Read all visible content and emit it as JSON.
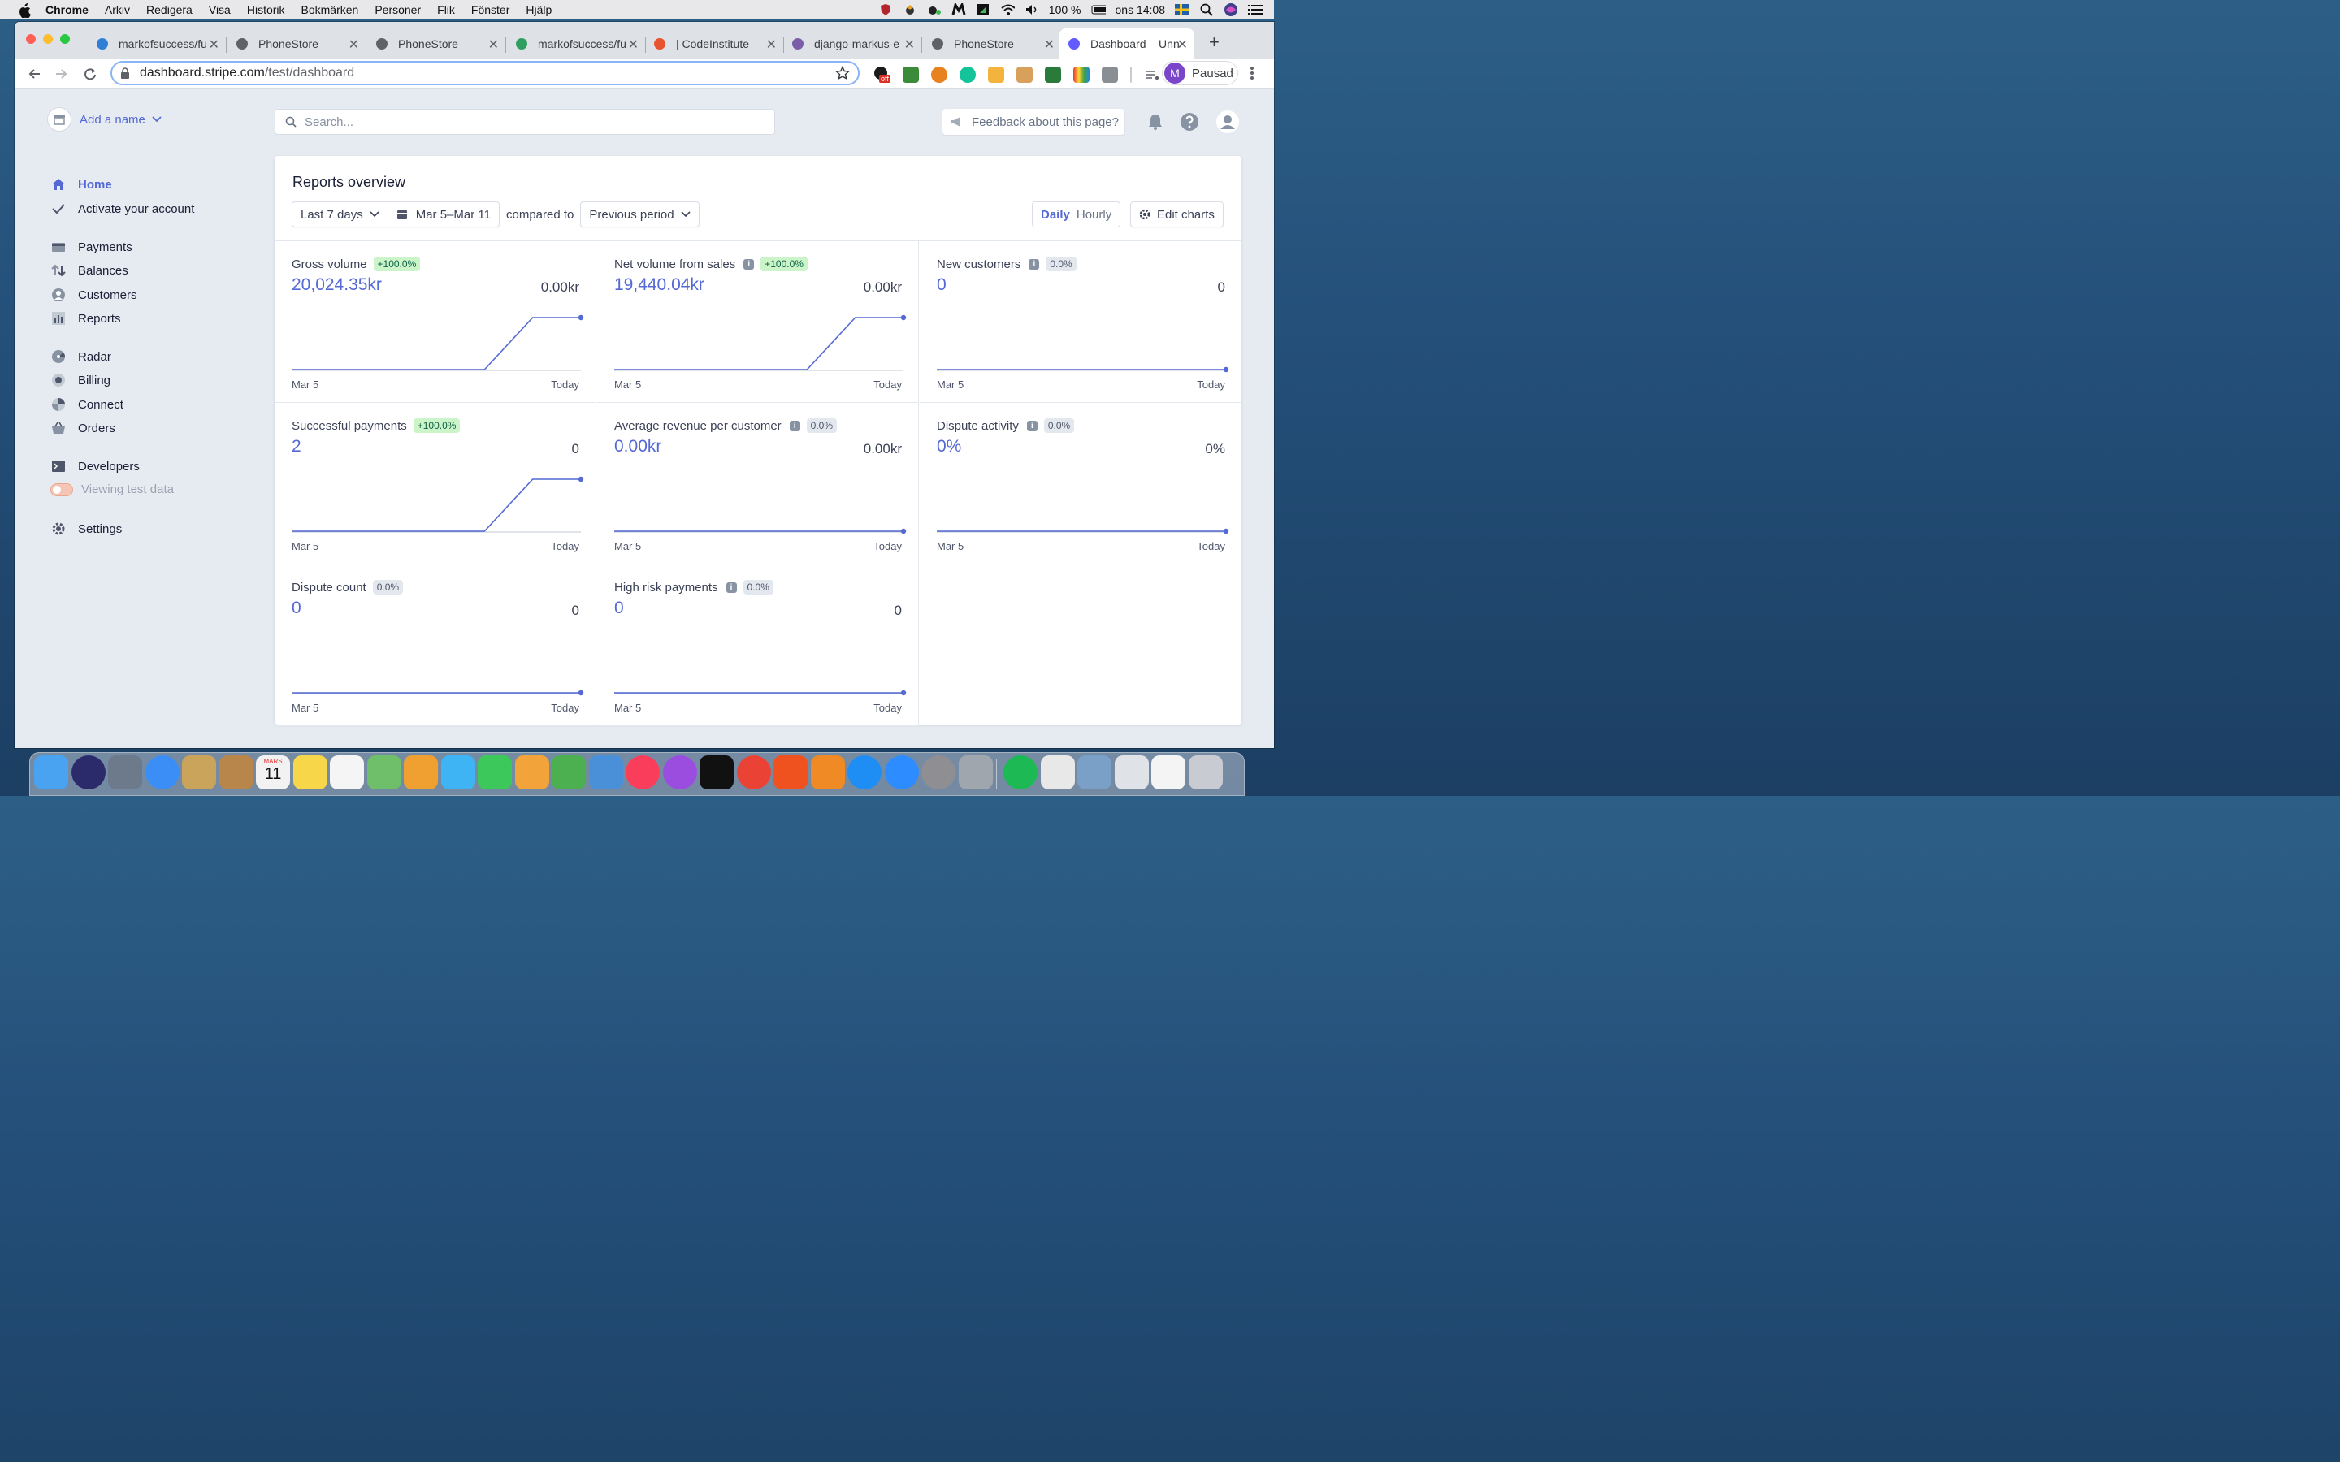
{
  "menubar": {
    "app": "Chrome",
    "items": [
      "Arkiv",
      "Redigera",
      "Visa",
      "Historik",
      "Bokmärken",
      "Personer",
      "Flik",
      "Fönster",
      "Hjälp"
    ],
    "battery": "100 %",
    "clock": "ons 14:08"
  },
  "browser": {
    "tabs": [
      {
        "title": "markofsuccess/fu",
        "icon": "hexagon-icon",
        "color": "#2f7ed8"
      },
      {
        "title": "PhoneStore",
        "icon": "globe-icon",
        "color": "#5f6368"
      },
      {
        "title": "PhoneStore",
        "icon": "globe-icon",
        "color": "#5f6368"
      },
      {
        "title": "markofsuccess/fu",
        "icon": "git-icon",
        "color": "#2e9f5e"
      },
      {
        "title": "| CodeInstitute",
        "icon": "ring-icon",
        "color": "#e8542f"
      },
      {
        "title": "django-markus-e",
        "icon": "heroku-icon",
        "color": "#7b5ea7"
      },
      {
        "title": "PhoneStore",
        "icon": "globe-icon",
        "color": "#5f6368"
      },
      {
        "title": "Dashboard – Unn",
        "icon": "stripe-icon",
        "color": "#635bff"
      }
    ],
    "url_domain": "dashboard.stripe.com",
    "url_path": "/test/dashboard",
    "profile_initial": "M",
    "profile_label": "Pausad",
    "extension_badge": "off"
  },
  "sidebar": {
    "account_name": "Add a name",
    "home": "Home",
    "activate": "Activate your account",
    "group1": [
      "Payments",
      "Balances",
      "Customers",
      "Reports"
    ],
    "group2": [
      "Radar",
      "Billing",
      "Connect",
      "Orders"
    ],
    "developers": "Developers",
    "test_toggle": "Viewing test data",
    "settings": "Settings"
  },
  "header": {
    "search_placeholder": "Search...",
    "feedback": "Feedback about this page?"
  },
  "reports": {
    "title": "Reports overview",
    "range": "Last 7 days",
    "dates": "Mar 5–Mar 11",
    "compared_to": "compared to",
    "comparison": "Previous period",
    "daily": "Daily",
    "hourly": "Hourly",
    "edit_charts": "Edit charts",
    "accent": "#5469d4",
    "metrics": [
      {
        "label": "Gross volume",
        "info": false,
        "badge": "+100.0%",
        "badge_type": "green",
        "value": "20,024.35kr",
        "previous": "0.00kr",
        "x_start": "Mar 5",
        "x_end": "Today",
        "trend": [
          0,
          0,
          0,
          0,
          0,
          1,
          1
        ]
      },
      {
        "label": "Net volume from sales",
        "info": true,
        "badge": "+100.0%",
        "badge_type": "green",
        "value": "19,440.04kr",
        "previous": "0.00kr",
        "x_start": "Mar 5",
        "x_end": "Today",
        "trend": [
          0,
          0,
          0,
          0,
          0,
          1,
          1
        ]
      },
      {
        "label": "New customers",
        "info": true,
        "badge": "0.0%",
        "badge_type": "gray",
        "value": "0",
        "previous": "0",
        "x_start": "Mar 5",
        "x_end": "Today",
        "trend": [
          0,
          0,
          0,
          0,
          0,
          0,
          0
        ]
      },
      {
        "label": "Successful payments",
        "info": false,
        "badge": "+100.0%",
        "badge_type": "green",
        "value": "2",
        "previous": "0",
        "x_start": "Mar 5",
        "x_end": "Today",
        "trend": [
          0,
          0,
          0,
          0,
          0,
          1,
          1
        ]
      },
      {
        "label": "Average revenue per customer",
        "info": true,
        "badge": "0.0%",
        "badge_type": "gray",
        "value": "0.00kr",
        "previous": "0.00kr",
        "x_start": "Mar 5",
        "x_end": "Today",
        "trend": [
          0,
          0,
          0,
          0,
          0,
          0,
          0
        ]
      },
      {
        "label": "Dispute activity",
        "info": true,
        "badge": "0.0%",
        "badge_type": "gray",
        "value": "0%",
        "previous": "0%",
        "x_start": "Mar 5",
        "x_end": "Today",
        "trend": [
          0,
          0,
          0,
          0,
          0,
          0,
          0
        ]
      },
      {
        "label": "Dispute count",
        "info": false,
        "badge": "0.0%",
        "badge_type": "gray",
        "value": "0",
        "previous": "0",
        "x_start": "Mar 5",
        "x_end": "Today",
        "trend": [
          0,
          0,
          0,
          0,
          0,
          0,
          0
        ]
      },
      {
        "label": "High risk payments",
        "info": true,
        "badge": "0.0%",
        "badge_type": "gray",
        "value": "0",
        "previous": "0",
        "x_start": "Mar 5",
        "x_end": "Today",
        "trend": [
          0,
          0,
          0,
          0,
          0,
          0,
          0
        ]
      }
    ]
  },
  "dock": {
    "calendar_month": "MARS",
    "calendar_day": "11",
    "items": [
      "finder-icon",
      "siri-icon",
      "launchpad-icon",
      "safari-icon",
      "mail-icon",
      "contacts-icon",
      "calendar-icon",
      "notes-icon",
      "reminders-icon",
      "maps-icon",
      "photos-icon",
      "messages-icon",
      "facetime-icon",
      "pages-icon",
      "numbers-icon",
      "keynote-icon",
      "music-icon",
      "podcasts-icon",
      "tv-icon",
      "chrome-icon",
      "brave-icon",
      "books-icon",
      "appstore-icon",
      "zoom-icon",
      "preferences-icon",
      "help-icon",
      "spotify-icon",
      "textedit-icon",
      "preview-icon",
      "downloads-icon",
      "documents-icon",
      "trash-icon"
    ],
    "colors": [
      "#4aa3f0",
      "#2b2b6b",
      "#6d7a8c",
      "#3a8ef5",
      "#c9a45a",
      "#b8864a",
      "#f2f2f2",
      "#f7d64a",
      "#f5f5f5",
      "#6fbf6a",
      "#f0a030",
      "#3fb4f5",
      "#3cc85a",
      "#f2a33a",
      "#4caf50",
      "#4a90d9",
      "#fa3d5b",
      "#9b4de0",
      "#111111",
      "#ea4335",
      "#f0521f",
      "#f08a24",
      "#1e8ef5",
      "#2d8cff",
      "#8e8e93",
      "#a0a6ad",
      "#1db954",
      "#e8e8e8",
      "#7aa0c8",
      "#dfe3e8",
      "#f4f4f4",
      "#c8ccd2"
    ]
  }
}
